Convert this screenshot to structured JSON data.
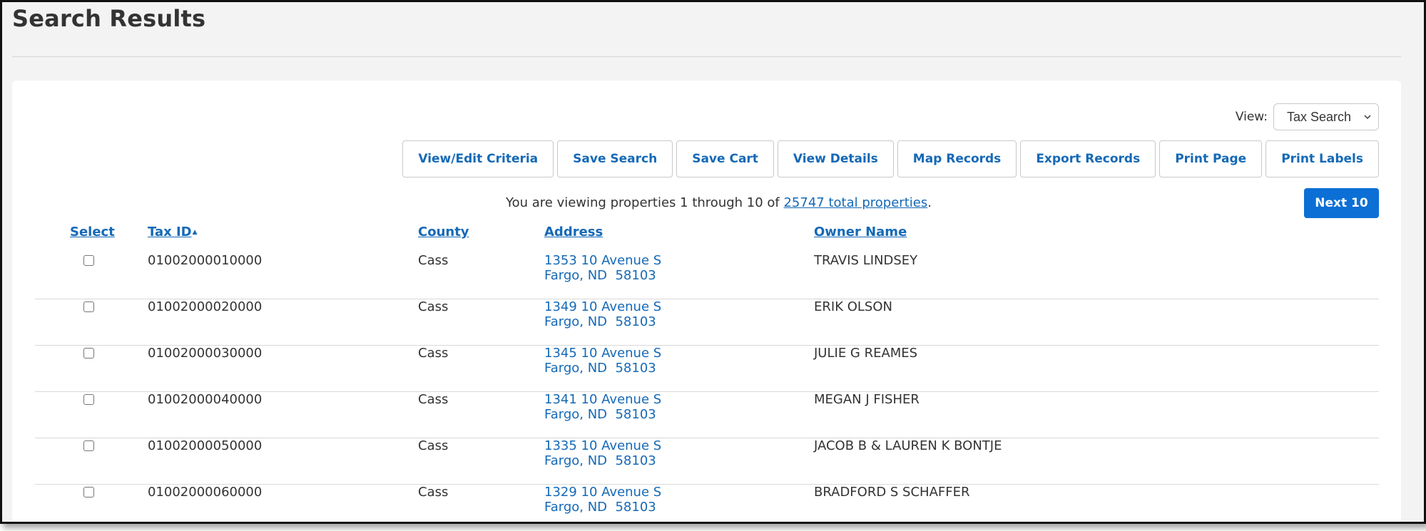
{
  "page": {
    "title": "Search Results"
  },
  "view": {
    "label": "View:",
    "selected": "Tax Search"
  },
  "toolbar": {
    "buttons": [
      "View/Edit Criteria",
      "Save Search",
      "Save Cart",
      "View Details",
      "Map Records",
      "Export Records",
      "Print Page",
      "Print Labels"
    ]
  },
  "summary": {
    "prefix": "You are viewing properties 1 through 10 of ",
    "link": "25747 total properties",
    "suffix": "."
  },
  "next_button": "Next 10",
  "columns": {
    "select": "Select",
    "taxid": "Tax ID",
    "county": "County",
    "address": "Address",
    "owner": "Owner Name"
  },
  "rows": [
    {
      "taxid": "01002000010000",
      "county": "Cass",
      "address_line1": "1353 10 Avenue S",
      "address_line2": "Fargo, ND  58103",
      "owner": "TRAVIS LINDSEY"
    },
    {
      "taxid": "01002000020000",
      "county": "Cass",
      "address_line1": "1349 10 Avenue S",
      "address_line2": "Fargo, ND  58103",
      "owner": "ERIK OLSON"
    },
    {
      "taxid": "01002000030000",
      "county": "Cass",
      "address_line1": "1345 10 Avenue S",
      "address_line2": "Fargo, ND  58103",
      "owner": "JULIE G REAMES"
    },
    {
      "taxid": "01002000040000",
      "county": "Cass",
      "address_line1": "1341 10 Avenue S",
      "address_line2": "Fargo, ND  58103",
      "owner": "MEGAN J FISHER"
    },
    {
      "taxid": "01002000050000",
      "county": "Cass",
      "address_line1": "1335 10 Avenue S",
      "address_line2": "Fargo, ND  58103",
      "owner": "JACOB B & LAUREN K BONTJE"
    },
    {
      "taxid": "01002000060000",
      "county": "Cass",
      "address_line1": "1329 10 Avenue S",
      "address_line2": "Fargo, ND  58103",
      "owner": "BRADFORD S SCHAFFER"
    }
  ]
}
